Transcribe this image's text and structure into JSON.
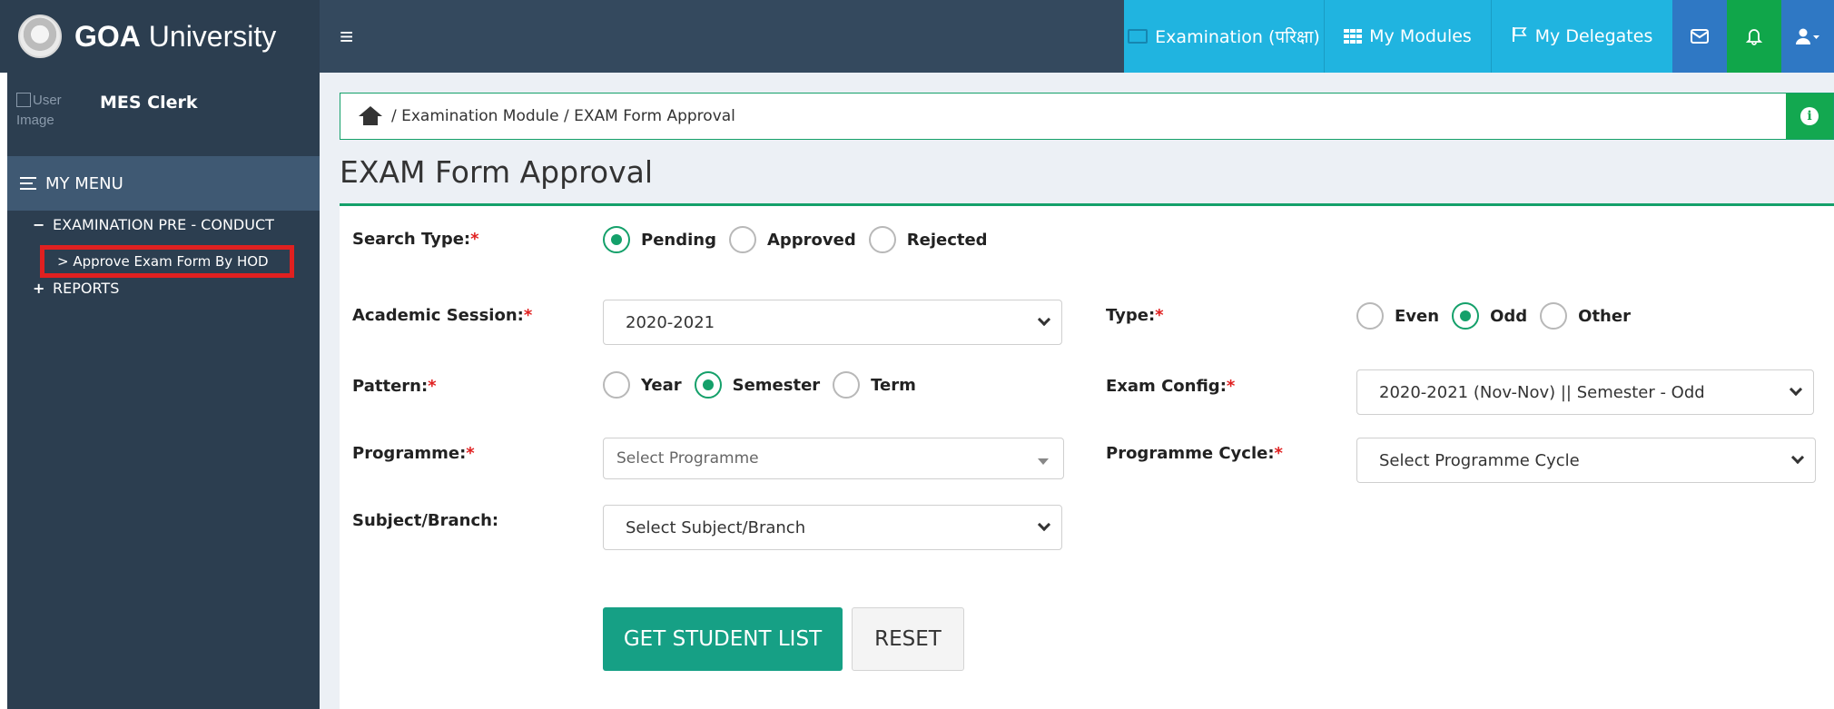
{
  "brand": {
    "bold": "GOA",
    "rest": " University"
  },
  "nav": {
    "examination": "Examination (परिक्षा)",
    "modules": "My Modules",
    "delegates": "My Delegates"
  },
  "user": {
    "image_alt_1": "User",
    "image_alt_2": "Image",
    "name": "MES Clerk"
  },
  "menu": {
    "header": "MY MENU",
    "exam_group": "EXAMINATION PRE - CONDUCT",
    "exam_sub": "> Approve Exam Form By HOD",
    "reports": "REPORTS",
    "minus": "−",
    "plus": "+"
  },
  "breadcrumb": "/ Examination Module / EXAM Form Approval",
  "page_title": "EXAM Form Approval",
  "form": {
    "search_type": {
      "label": "Search Type:",
      "options": [
        "Pending",
        "Approved",
        "Rejected"
      ],
      "selected": "Pending"
    },
    "academic_session": {
      "label": "Academic Session:",
      "value": "2020-2021"
    },
    "type": {
      "label": "Type:",
      "options": [
        "Even",
        "Odd",
        "Other"
      ],
      "selected": "Odd"
    },
    "pattern": {
      "label": "Pattern:",
      "options": [
        "Year",
        "Semester",
        "Term"
      ],
      "selected": "Semester"
    },
    "exam_config": {
      "label": "Exam Config:",
      "value": "2020-2021 (Nov-Nov) || Semester - Odd"
    },
    "programme": {
      "label": "Programme:",
      "placeholder": "Select Programme"
    },
    "programme_cycle": {
      "label": "Programme Cycle:",
      "value": "Select Programme Cycle"
    },
    "subject_branch": {
      "label": "Subject/Branch:",
      "value": "Select Subject/Branch"
    },
    "required_mark": "*"
  },
  "buttons": {
    "get_list": "GET STUDENT LIST",
    "reset": "RESET"
  },
  "colors": {
    "accent": "#16a085",
    "sidebar": "#2c3e50",
    "topbar": "#34495e",
    "nav_blue": "#20b4e0",
    "highlight": "#e02020"
  }
}
